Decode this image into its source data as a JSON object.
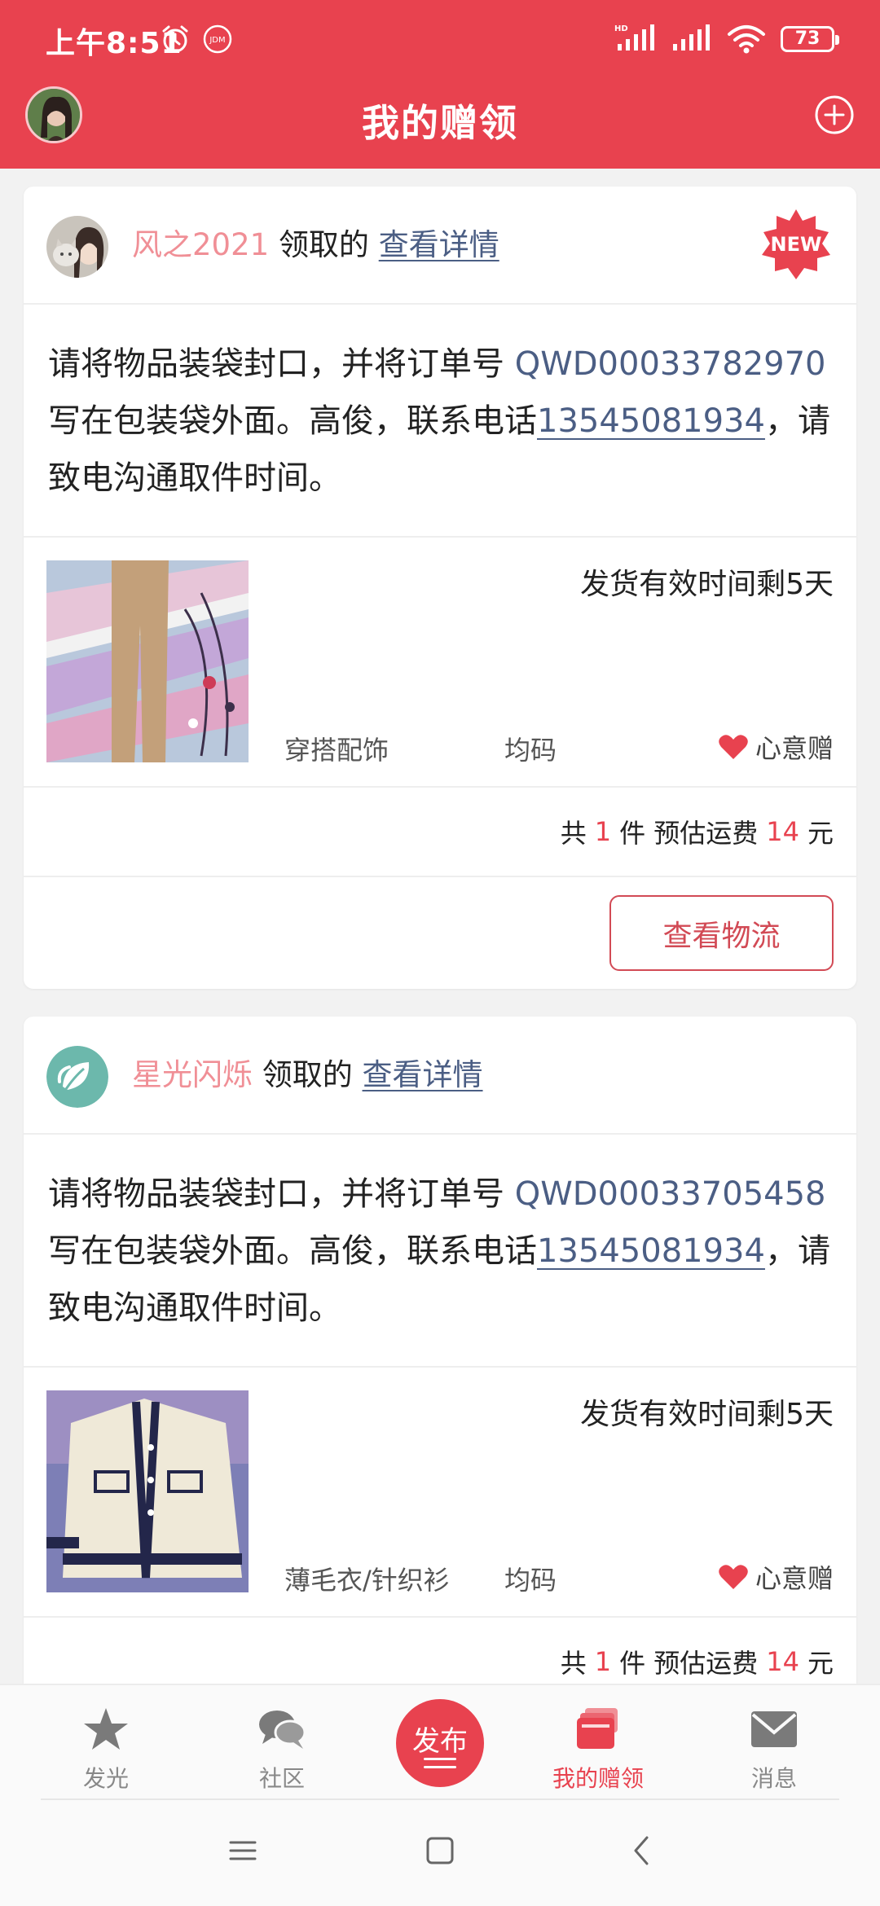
{
  "status_bar": {
    "time": "上午8:51",
    "icons_left": [
      "alarm-icon",
      "jdm-icon"
    ],
    "icons_right": [
      "hd-signal-icon",
      "signal-icon",
      "wifi-icon",
      "battery-icon"
    ],
    "battery": "73"
  },
  "app_bar": {
    "title": "我的赠领",
    "avatar": "user-avatar",
    "plus": "add-icon"
  },
  "cards": [
    {
      "donor": "风之2021",
      "claim_text": "领取的",
      "detail_link": "查看详情",
      "new_badge": "NEW",
      "msg_prefix": "请将物品装袋封口，并将订单号 ",
      "order_no": "QWD00033782970",
      "msg_middle": " 写在包装袋外面。高俊，联系电话",
      "phone": "13545081934",
      "msg_suffix": "，请致电沟通取件时间。",
      "deadline": "发货有效时间剩5天",
      "category": "穿搭配饰",
      "size": "均码",
      "type": "心意赠",
      "total_prefix": "共",
      "count": "1",
      "total_mid": "件 预估运费",
      "fee": "14",
      "total_unit": "元",
      "action": "查看物流"
    },
    {
      "donor": "星光闪烁",
      "claim_text": "领取的",
      "detail_link": "查看详情",
      "msg_prefix": "请将物品装袋封口，并将订单号 ",
      "order_no": "QWD00033705458",
      "msg_middle": " 写在包装袋外面。高俊，联系电话",
      "phone": "13545081934",
      "msg_suffix": "，请致电沟通取件时间。",
      "deadline": "发货有效时间剩5天",
      "category": "薄毛衣/针织衫",
      "size": "均码",
      "type": "心意赠",
      "total_prefix": "共",
      "count": "1",
      "total_mid": "件 预估运费",
      "fee": "14",
      "total_unit": "元"
    }
  ],
  "tabbar": {
    "tabs": [
      {
        "label": "发光",
        "icon": "star-icon"
      },
      {
        "label": "社区",
        "icon": "chat-bubbles-icon"
      },
      {
        "label": "发布",
        "icon": "publish-icon"
      },
      {
        "label": "我的赠领",
        "icon": "gift-cards-icon",
        "active": true
      },
      {
        "label": "消息",
        "icon": "mail-icon"
      }
    ]
  },
  "colors": {
    "brand_red": "#e8424f",
    "link_blue": "#4b5e84",
    "donor_pink": "#f08f96"
  }
}
